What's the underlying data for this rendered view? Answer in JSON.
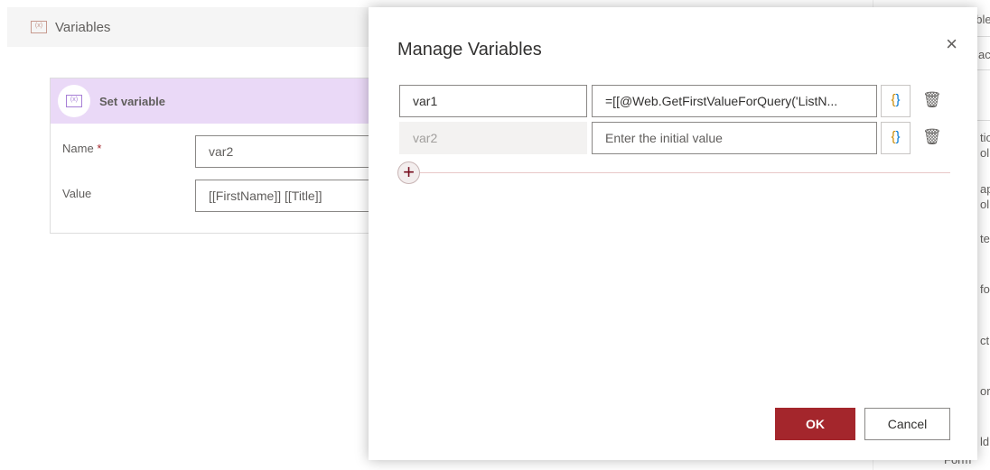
{
  "header": {
    "title": "Variables",
    "icon": "variable-icon"
  },
  "card": {
    "title": "Set variable",
    "name_label": "Name",
    "required": "*",
    "name_value": "var2",
    "value_label": "Value",
    "value_value": "[[FirstName]] [[Title]]"
  },
  "right_panel": {
    "fragments": [
      "ailable Ac",
      "ac",
      "tio",
      "ol",
      "ap",
      "ol",
      "te s",
      "for",
      "ct",
      "orr",
      "ld",
      "Form"
    ]
  },
  "dialog": {
    "title": "Manage Variables",
    "close": "×",
    "rows": [
      {
        "name": "var1",
        "value": "=[[@Web.GetFirstValueForQuery('ListN...",
        "placeholder": ""
      },
      {
        "name": "var2",
        "value": "",
        "placeholder": "Enter the initial value"
      }
    ],
    "brace_open": "{",
    "brace_close": "}",
    "trash": "🗑",
    "add": "+",
    "ok": "OK",
    "cancel": "Cancel"
  },
  "colors": {
    "accent": "#a4262c",
    "card_header": "#ead9f7"
  }
}
